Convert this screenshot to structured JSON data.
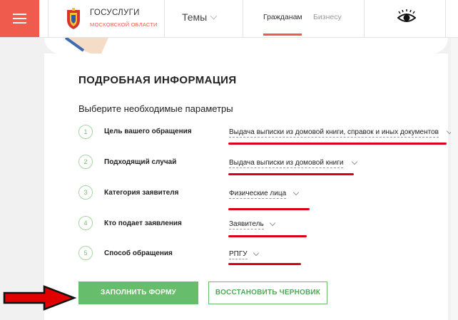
{
  "header": {
    "brand": "ГОСУСЛУГИ",
    "region": "МОСКОВСКОЙ ОБЛАСТИ",
    "themes": "Темы",
    "nav_citizens": "Гражданам",
    "nav_business": "Бизнесу"
  },
  "section": {
    "title": "ПОДРОБНАЯ ИНФОРМАЦИЯ",
    "subtitle": "Выберите необходимые параметры"
  },
  "params": [
    {
      "num": "1",
      "label": "Цель вашего обращения",
      "value": "Выдача выписки из домовой книги, справок и иных документов"
    },
    {
      "num": "2",
      "label": "Подходящий случай",
      "value": "Выдача выписки из домовой книги"
    },
    {
      "num": "3",
      "label": "Категория заявителя",
      "value": "Физические лица"
    },
    {
      "num": "4",
      "label": "Кто подает заявления",
      "value": "Заявитель"
    },
    {
      "num": "5",
      "label": "Способ обращения",
      "value": "РПГУ"
    }
  ],
  "buttons": {
    "fill_form": "ЗАПОЛНИТЬ ФОРМУ",
    "restore_draft": "ВОССТАНОВИТЬ ЧЕРНОВИК"
  },
  "colors": {
    "accent_red": "#ef5b4c",
    "green": "#66bd6b",
    "annotation_red": "#d9001b"
  },
  "icons": {
    "menu": "hamburger-icon",
    "logo": "coat-of-arms-icon",
    "accessibility": "eye-icon",
    "annotation": "arrow-right-icon"
  }
}
